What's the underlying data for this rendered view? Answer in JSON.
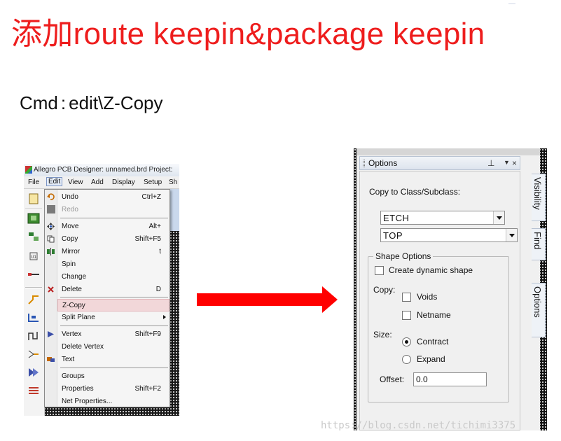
{
  "slide": {
    "title": "添加route keepin&package keepin",
    "command_label": "Cmd",
    "command_sep": ":",
    "command_value": "edit\\Z-Copy",
    "watermark": "https://blog.csdn.net/tichimi3375"
  },
  "left_screenshot": {
    "window_title": "Allegro PCB Designer: unnamed.brd  Project:",
    "menubar": [
      "File",
      "Edit",
      "View",
      "Add",
      "Display",
      "Setup",
      "Sh"
    ],
    "active_menu": "Edit",
    "edit_menu": {
      "items": [
        {
          "label": "Undo",
          "shortcut": "Ctrl+Z",
          "icon": "undo-icon"
        },
        {
          "label": "Redo",
          "shortcut": "",
          "icon": "redo-icon",
          "disabled": true
        },
        {
          "label": "Move",
          "shortcut": "Alt+",
          "icon": "move-icon"
        },
        {
          "label": "Copy",
          "shortcut": "Shift+F5",
          "icon": "copy-icon"
        },
        {
          "label": "Mirror",
          "shortcut": "t",
          "icon": "mirror-icon"
        },
        {
          "label": "Spin",
          "shortcut": "",
          "icon": ""
        },
        {
          "label": "Change",
          "shortcut": "",
          "icon": ""
        },
        {
          "label": "Delete",
          "shortcut": "D",
          "icon": "delete-icon"
        },
        {
          "label": "Z-Copy",
          "shortcut": "",
          "icon": "",
          "highlighted": true
        },
        {
          "label": "Split Plane",
          "shortcut": "",
          "icon": "",
          "submenu": true
        },
        {
          "label": "Vertex",
          "shortcut": "Shift+F9",
          "icon": "vertex-icon"
        },
        {
          "label": "Delete Vertex",
          "shortcut": "",
          "icon": ""
        },
        {
          "label": "Text",
          "shortcut": "",
          "icon": "text-icon"
        },
        {
          "label": "Groups",
          "shortcut": "",
          "icon": ""
        },
        {
          "label": "Properties",
          "shortcut": "Shift+F2",
          "icon": ""
        },
        {
          "label": "Net Properties...",
          "shortcut": "",
          "icon": ""
        }
      ]
    }
  },
  "options_panel": {
    "title": "Options",
    "pin_glyph": "⊥",
    "menu_glyph": "▼",
    "close_glyph": "×",
    "copy_to_label": "Copy to Class/Subclass:",
    "class_value": "ETCH",
    "subclass_value": "TOP",
    "shape_options_label": "Shape Options",
    "create_dynamic_label": "Create dynamic shape",
    "copy_label": "Copy:",
    "voids_label": "Voids",
    "netname_label": "Netname",
    "size_label": "Size:",
    "contract_label": "Contract",
    "expand_label": "Expand",
    "size_selected": "Contract",
    "offset_label": "Offset:",
    "offset_value": "0.0",
    "side_tabs": [
      "Visibility",
      "Find",
      "Options"
    ]
  },
  "colors": {
    "title_red": "#ee1d1d",
    "arrow_red": "#ff0000",
    "menu_highlight": "#f2d7d9"
  }
}
